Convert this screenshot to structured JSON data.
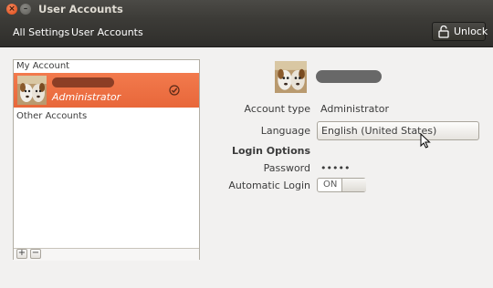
{
  "window": {
    "title": "User Accounts"
  },
  "toolbar": {
    "all_settings": "All Settings",
    "user_accounts": "User Accounts",
    "unlock_label": "Unlock",
    "unlock_icon": "lock-icon"
  },
  "accounts": {
    "my_account_header": "My Account",
    "selected_role": "Administrator",
    "other_accounts_header": "Other Accounts",
    "add_label": "+",
    "remove_label": "−",
    "accent_color": "#e9693b"
  },
  "details": {
    "account_type_label": "Account type",
    "account_type_value": "Administrator",
    "language_label": "Language",
    "language_value": "English (United States)",
    "login_options_header": "Login Options",
    "password_label": "Password",
    "password_value": "•••••",
    "auto_login_label": "Automatic Login",
    "auto_login_state": "ON"
  }
}
